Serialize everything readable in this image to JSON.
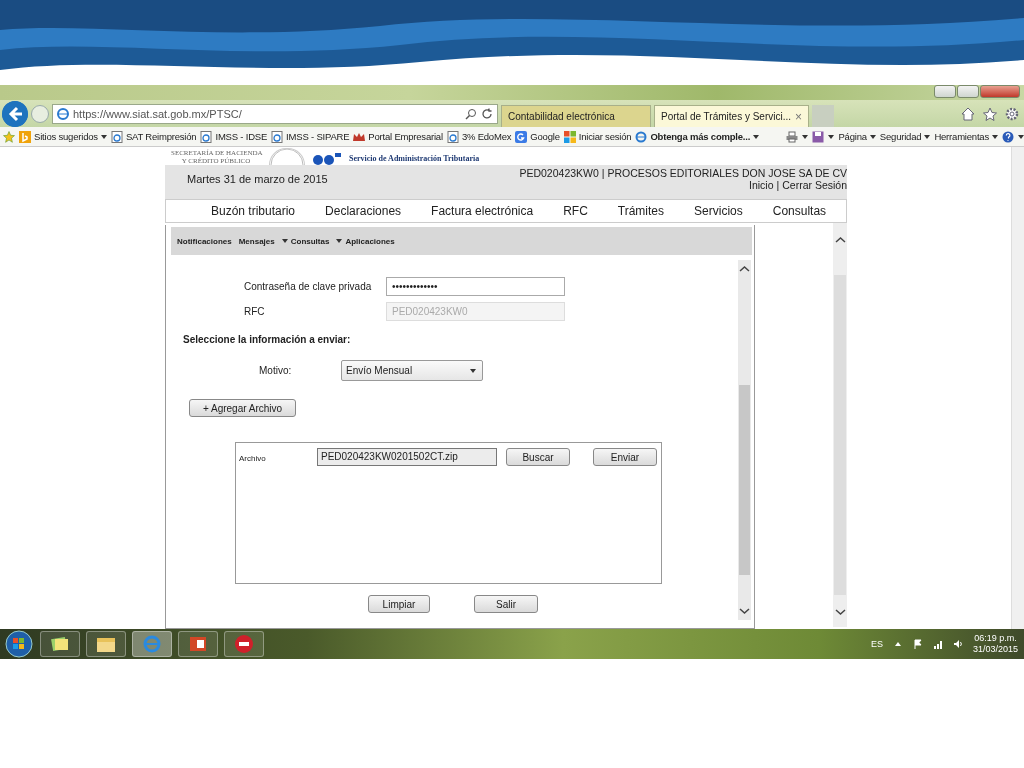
{
  "browser": {
    "url": "https://www.siat.sat.gob.mx/PTSC/",
    "tabs": [
      {
        "label": "Contabilidad electrónica",
        "selected": false
      },
      {
        "label": "Portal de Trámites y Servici...",
        "selected": true,
        "close": "×"
      }
    ],
    "favorites": [
      {
        "label": "Sitios sugeridos",
        "kind": "bing",
        "dropdown": true,
        "bold": false
      },
      {
        "label": "SAT Reimpresión",
        "kind": "page",
        "dropdown": false,
        "bold": false
      },
      {
        "label": "IMSS - IDSE",
        "kind": "page",
        "dropdown": false,
        "bold": false
      },
      {
        "label": "IMSS - SIPARE",
        "kind": "page",
        "dropdown": false,
        "bold": false
      },
      {
        "label": "Portal Empresarial",
        "kind": "portal",
        "dropdown": false,
        "bold": false
      },
      {
        "label": "3% EdoMex",
        "kind": "page",
        "dropdown": false,
        "bold": false
      },
      {
        "label": "Google",
        "kind": "google",
        "dropdown": false,
        "bold": false
      },
      {
        "label": "Iniciar sesión",
        "kind": "windows",
        "dropdown": false,
        "bold": false
      },
      {
        "label": "Obtenga más comple...",
        "kind": "ie",
        "dropdown": true,
        "bold": true
      }
    ],
    "commands": [
      "Página",
      "Seguridad",
      "Herramientas"
    ]
  },
  "page": {
    "agency_lines": [
      "SECRETARÍA DE HACIENDA",
      "Y CRÉDITO PÚBLICO"
    ],
    "sat_subtitle": "Servicio de Administración Tributaria",
    "date": "Martes 31 de marzo de 2015",
    "user": "PED020423KW0 | PROCESOS EDITORIALES DON JOSE SA DE CV",
    "links": [
      "Inicio",
      "Cerrar Sesión"
    ],
    "link_separator": "|",
    "menu": [
      "Buzón tributario",
      "Declaraciones",
      "Factura electrónica",
      "RFC",
      "Trámites",
      "Servicios",
      "Consultas"
    ],
    "submenu": [
      {
        "label": "Notificaciones",
        "dropdown": false
      },
      {
        "label": "Mensajes",
        "dropdown": false
      },
      {
        "label": "Consultas",
        "dropdown": true
      },
      {
        "label": "Aplicaciones",
        "dropdown": true
      }
    ]
  },
  "form": {
    "fields": [
      {
        "label": "Contraseña de clave privada",
        "value": "•••••••••••••",
        "disabled": false
      },
      {
        "label": "RFC",
        "value": "PED020423KW0",
        "disabled": true
      }
    ],
    "section_title": "Seleccione la información a enviar:",
    "motivo_label": "Motivo:",
    "motivo_value": "Envío Mensual",
    "add_button": "+ Agregar Archivo",
    "file_panel": {
      "label": "Archivo",
      "file": "PED020423KW0201502CT.zip",
      "buttons": [
        "Buscar",
        "Enviar"
      ]
    },
    "buttons": [
      "Limpiar",
      "Salir"
    ]
  },
  "taskbar": {
    "apps": [
      {
        "kind": "notes",
        "selected": false
      },
      {
        "kind": "folder",
        "selected": false
      },
      {
        "kind": "ie",
        "selected": true
      },
      {
        "kind": "ppt",
        "selected": false
      },
      {
        "kind": "cf",
        "selected": false
      }
    ],
    "language": "ES",
    "time": "06:19 p.m.",
    "date": "31/03/2015"
  }
}
